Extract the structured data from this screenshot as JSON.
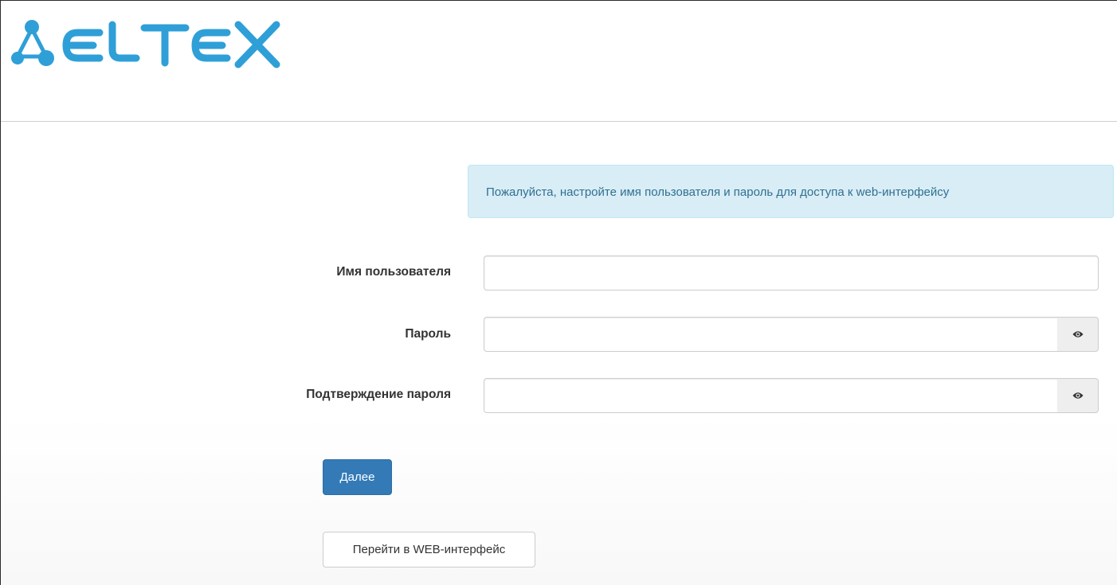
{
  "brand": {
    "logo_text": "ELTEX",
    "logo_color": "#2f9fd8"
  },
  "alert": {
    "text": "Пожалуйста, настройте имя пользователя и пароль для доступа к web-интерфейсу"
  },
  "form": {
    "username": {
      "label": "Имя пользователя",
      "value": ""
    },
    "password": {
      "label": "Пароль",
      "value": "",
      "toggle_icon": "eye-icon"
    },
    "confirm": {
      "label": "Подтверждение пароля",
      "value": "",
      "toggle_icon": "eye-icon"
    }
  },
  "actions": {
    "next_label": "Далее",
    "web_label": "Перейти в WEB-интерфейс"
  },
  "colors": {
    "primary": "#337ab7",
    "alert_bg": "#d9edf7",
    "alert_text": "#31708f"
  }
}
